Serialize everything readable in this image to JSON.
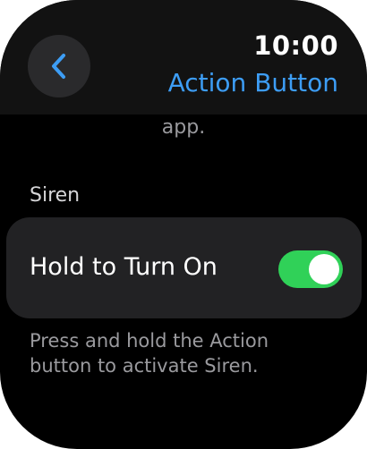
{
  "status": {
    "time": "10:00"
  },
  "nav": {
    "title": "Action Button",
    "back_icon": "chevron-left-icon",
    "accent_color": "#3d9df5"
  },
  "content": {
    "clipped_text": "app.",
    "section_header": "Siren",
    "toggle_row": {
      "label": "Hold to Turn On",
      "state": "on",
      "on_color": "#30d158"
    },
    "footer": "Press and hold the Action button to activate Siren."
  }
}
